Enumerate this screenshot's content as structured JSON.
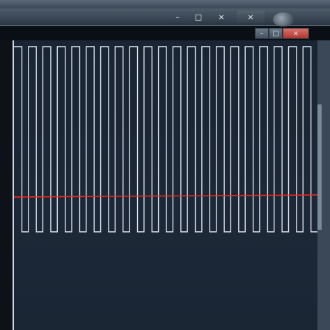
{
  "back_window": {
    "minimize_label": "–",
    "maximize_label": "□",
    "close_label": "×",
    "second_close_label": "×"
  },
  "front_window": {
    "minimize_label": "–",
    "maximize_label": "□",
    "close_label": "×"
  },
  "waveform": {
    "type": "square-wave",
    "trace_color": "#dfe6ee",
    "cursor_color": "#ff2a1a",
    "background": "#1b2634",
    "pulses": 21,
    "duty_cycle": 0.55
  }
}
